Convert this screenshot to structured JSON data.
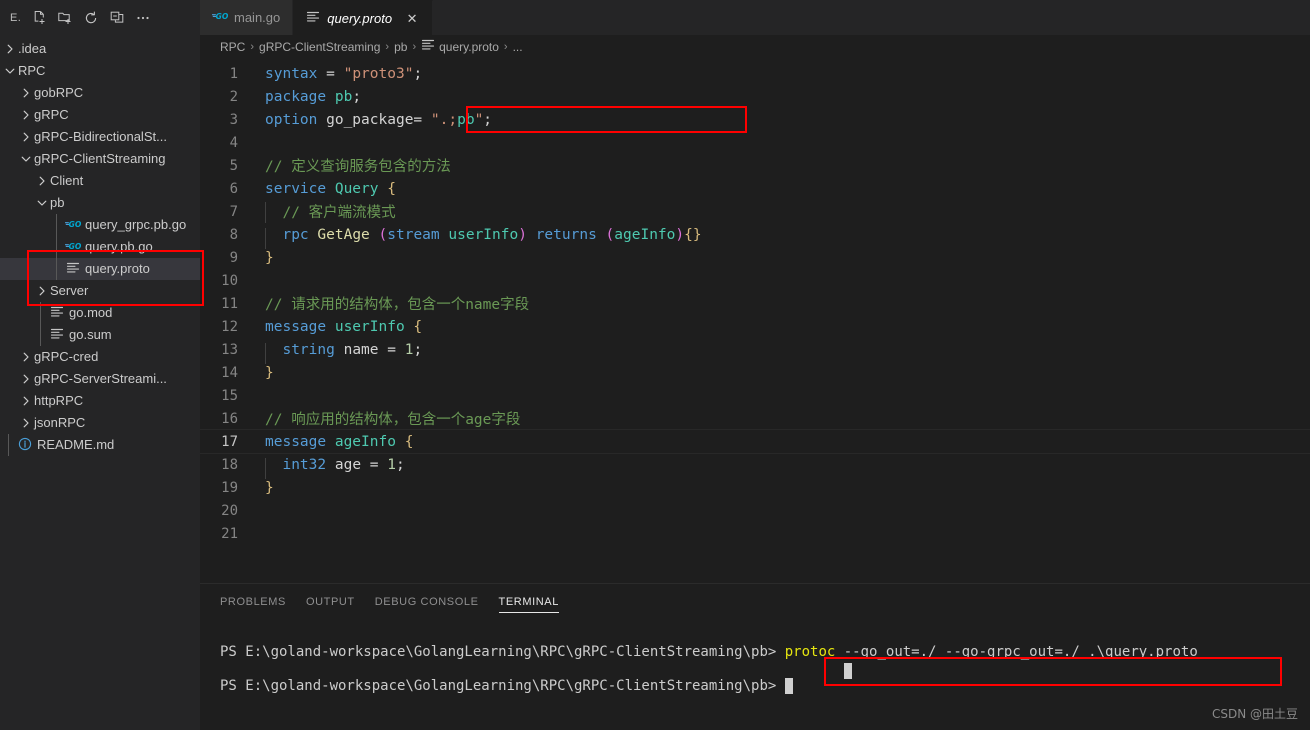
{
  "sidebar": {
    "title": "E.",
    "actions": [
      {
        "name": "new-file-icon",
        "tooltip": "New File"
      },
      {
        "name": "new-folder-icon",
        "tooltip": "New Folder"
      },
      {
        "name": "refresh-icon",
        "tooltip": "Refresh Explorer"
      },
      {
        "name": "collapse-all-icon",
        "tooltip": "Collapse Folders in Explorer"
      },
      {
        "name": "more-actions-icon",
        "tooltip": "Views and More Actions..."
      }
    ],
    "tree": [
      {
        "label": ".idea",
        "depth": 1,
        "kind": "folder",
        "state": "collapsed"
      },
      {
        "label": "RPC",
        "depth": 1,
        "kind": "folder",
        "state": "expanded"
      },
      {
        "label": "gobRPC",
        "depth": 2,
        "kind": "folder",
        "state": "collapsed"
      },
      {
        "label": "gRPC",
        "depth": 2,
        "kind": "folder",
        "state": "collapsed"
      },
      {
        "label": "gRPC-BidirectionalSt...",
        "depth": 2,
        "kind": "folder",
        "state": "collapsed"
      },
      {
        "label": "gRPC-ClientStreaming",
        "depth": 2,
        "kind": "folder",
        "state": "expanded"
      },
      {
        "label": "Client",
        "depth": 3,
        "kind": "folder",
        "state": "collapsed"
      },
      {
        "label": "pb",
        "depth": 3,
        "kind": "folder",
        "state": "expanded"
      },
      {
        "label": "query_grpc.pb.go",
        "depth": 4,
        "kind": "go",
        "state": "file"
      },
      {
        "label": "query.pb.go",
        "depth": 4,
        "kind": "go",
        "state": "file"
      },
      {
        "label": "query.proto",
        "depth": 4,
        "kind": "proto",
        "state": "file",
        "selected": true
      },
      {
        "label": "Server",
        "depth": 3,
        "kind": "folder",
        "state": "collapsed"
      },
      {
        "label": "go.mod",
        "depth": 3,
        "kind": "proto",
        "state": "file"
      },
      {
        "label": "go.sum",
        "depth": 3,
        "kind": "proto",
        "state": "file"
      },
      {
        "label": "gRPC-cred",
        "depth": 2,
        "kind": "folder",
        "state": "collapsed"
      },
      {
        "label": "gRPC-ServerStreami...",
        "depth": 2,
        "kind": "folder",
        "state": "collapsed"
      },
      {
        "label": "httpRPC",
        "depth": 2,
        "kind": "folder",
        "state": "collapsed"
      },
      {
        "label": "jsonRPC",
        "depth": 2,
        "kind": "folder",
        "state": "collapsed"
      },
      {
        "label": "README.md",
        "depth": 1,
        "kind": "info",
        "state": "file"
      }
    ]
  },
  "tabs": [
    {
      "label": "main.go",
      "icon": "go-icon",
      "active": false,
      "closable": false
    },
    {
      "label": "query.proto",
      "icon": "proto-icon",
      "active": true,
      "closable": true,
      "close_label": "✕"
    }
  ],
  "breadcrumb": {
    "separator": "›",
    "items": [
      {
        "label": "RPC",
        "icon": ""
      },
      {
        "label": "gRPC-ClientStreaming",
        "icon": ""
      },
      {
        "label": "pb",
        "icon": ""
      },
      {
        "label": "query.proto",
        "icon": "proto-icon"
      },
      {
        "label": "...",
        "icon": ""
      }
    ]
  },
  "editor": {
    "language": "proto",
    "current_line": 17,
    "lines": [
      {
        "n": 1,
        "indent": 0,
        "tokens": [
          {
            "t": "key",
            "v": "syntax"
          },
          {
            "t": "plain",
            "v": " = "
          },
          {
            "t": "str",
            "v": "\"proto3\""
          },
          {
            "t": "plain",
            "v": ";"
          }
        ]
      },
      {
        "n": 2,
        "indent": 0,
        "tokens": [
          {
            "t": "key",
            "v": "package"
          },
          {
            "t": "plain",
            "v": " "
          },
          {
            "t": "type",
            "v": "pb"
          },
          {
            "t": "plain",
            "v": ";"
          }
        ]
      },
      {
        "n": 3,
        "indent": 0,
        "highlight": true,
        "tokens": [
          {
            "t": "key",
            "v": "option"
          },
          {
            "t": "plain",
            "v": " go_package= "
          },
          {
            "t": "str",
            "v": "\".;"
          },
          {
            "t": "type",
            "v": "pb"
          },
          {
            "t": "str",
            "v": "\""
          },
          {
            "t": "plain",
            "v": ";"
          }
        ]
      },
      {
        "n": 4,
        "indent": 0,
        "tokens": []
      },
      {
        "n": 5,
        "indent": 0,
        "tokens": [
          {
            "t": "cmt",
            "v": "// 定义查询服务包含的方法"
          }
        ]
      },
      {
        "n": 6,
        "indent": 0,
        "tokens": [
          {
            "t": "key",
            "v": "service"
          },
          {
            "t": "plain",
            "v": " "
          },
          {
            "t": "type",
            "v": "Query"
          },
          {
            "t": "plain",
            "v": " "
          },
          {
            "t": "brace",
            "v": "{"
          }
        ]
      },
      {
        "n": 7,
        "indent": 1,
        "tokens": [
          {
            "t": "cmt",
            "v": "  // 客户端流模式"
          }
        ]
      },
      {
        "n": 8,
        "indent": 1,
        "tokens": [
          {
            "t": "plain",
            "v": "  "
          },
          {
            "t": "key",
            "v": "rpc"
          },
          {
            "t": "plain",
            "v": " "
          },
          {
            "t": "fn",
            "v": "GetAge"
          },
          {
            "t": "plain",
            "v": " "
          },
          {
            "t": "paren",
            "v": "("
          },
          {
            "t": "key",
            "v": "stream"
          },
          {
            "t": "plain",
            "v": " "
          },
          {
            "t": "type",
            "v": "userInfo"
          },
          {
            "t": "paren",
            "v": ")"
          },
          {
            "t": "plain",
            "v": " "
          },
          {
            "t": "key",
            "v": "returns"
          },
          {
            "t": "plain",
            "v": " "
          },
          {
            "t": "paren",
            "v": "("
          },
          {
            "t": "type",
            "v": "ageInfo"
          },
          {
            "t": "paren",
            "v": ")"
          },
          {
            "t": "brace",
            "v": "{}"
          }
        ]
      },
      {
        "n": 9,
        "indent": 0,
        "tokens": [
          {
            "t": "brace",
            "v": "}"
          }
        ]
      },
      {
        "n": 10,
        "indent": 0,
        "tokens": []
      },
      {
        "n": 11,
        "indent": 0,
        "tokens": [
          {
            "t": "cmt",
            "v": "// 请求用的结构体，包含一个name字段"
          }
        ]
      },
      {
        "n": 12,
        "indent": 0,
        "tokens": [
          {
            "t": "key",
            "v": "message"
          },
          {
            "t": "plain",
            "v": " "
          },
          {
            "t": "type",
            "v": "userInfo"
          },
          {
            "t": "plain",
            "v": " "
          },
          {
            "t": "brace",
            "v": "{"
          }
        ]
      },
      {
        "n": 13,
        "indent": 1,
        "tokens": [
          {
            "t": "plain",
            "v": "  "
          },
          {
            "t": "key",
            "v": "string"
          },
          {
            "t": "plain",
            "v": " "
          },
          {
            "t": "plain",
            "v": "name"
          },
          {
            "t": "plain",
            "v": " = "
          },
          {
            "t": "num",
            "v": "1"
          },
          {
            "t": "plain",
            "v": ";"
          }
        ]
      },
      {
        "n": 14,
        "indent": 0,
        "tokens": [
          {
            "t": "brace",
            "v": "}"
          }
        ]
      },
      {
        "n": 15,
        "indent": 0,
        "tokens": []
      },
      {
        "n": 16,
        "indent": 0,
        "tokens": [
          {
            "t": "cmt",
            "v": "// 响应用的结构体，包含一个age字段"
          }
        ]
      },
      {
        "n": 17,
        "indent": 0,
        "tokens": [
          {
            "t": "key",
            "v": "message"
          },
          {
            "t": "plain",
            "v": " "
          },
          {
            "t": "type",
            "v": "ageInfo"
          },
          {
            "t": "plain",
            "v": " "
          },
          {
            "t": "brace",
            "v": "{"
          }
        ]
      },
      {
        "n": 18,
        "indent": 1,
        "tokens": [
          {
            "t": "plain",
            "v": "  "
          },
          {
            "t": "key",
            "v": "int32"
          },
          {
            "t": "plain",
            "v": " "
          },
          {
            "t": "plain",
            "v": "age"
          },
          {
            "t": "plain",
            "v": " = "
          },
          {
            "t": "num",
            "v": "1"
          },
          {
            "t": "plain",
            "v": ";"
          }
        ]
      },
      {
        "n": 19,
        "indent": 0,
        "tokens": [
          {
            "t": "brace",
            "v": "}"
          }
        ]
      },
      {
        "n": 20,
        "indent": 0,
        "tokens": []
      },
      {
        "n": 21,
        "indent": 0,
        "tokens": []
      }
    ]
  },
  "panel": {
    "tabs": [
      {
        "label": "PROBLEMS",
        "active": false
      },
      {
        "label": "OUTPUT",
        "active": false
      },
      {
        "label": "DEBUG CONSOLE",
        "active": false
      },
      {
        "label": "TERMINAL",
        "active": true
      }
    ],
    "terminal": {
      "prompt": "PS E:\\goland-workspace\\GolangLearning\\RPC\\gRPC-ClientStreaming\\pb> ",
      "command_name": "protoc",
      "command_args": " --go_out=./ --go-grpc_out=./ .\\query.proto",
      "second_prompt": "PS E:\\goland-workspace\\GolangLearning\\RPC\\gRPC-ClientStreaming\\pb> "
    }
  },
  "watermark": "CSDN @田土豆",
  "colors": {
    "annotation": "#ff0000",
    "sidebar_bg": "#252526",
    "editor_bg": "#1e1e1e",
    "selection_bg": "#37373d",
    "keyword": "#569cd6",
    "type": "#4ec9b0",
    "string": "#ce9178",
    "comment": "#6a9955",
    "function": "#dcdcaa",
    "number": "#b5cea8",
    "brace": "#d7ba7d",
    "paren": "#da70d6",
    "terminal_cmd": "#e5e510"
  }
}
